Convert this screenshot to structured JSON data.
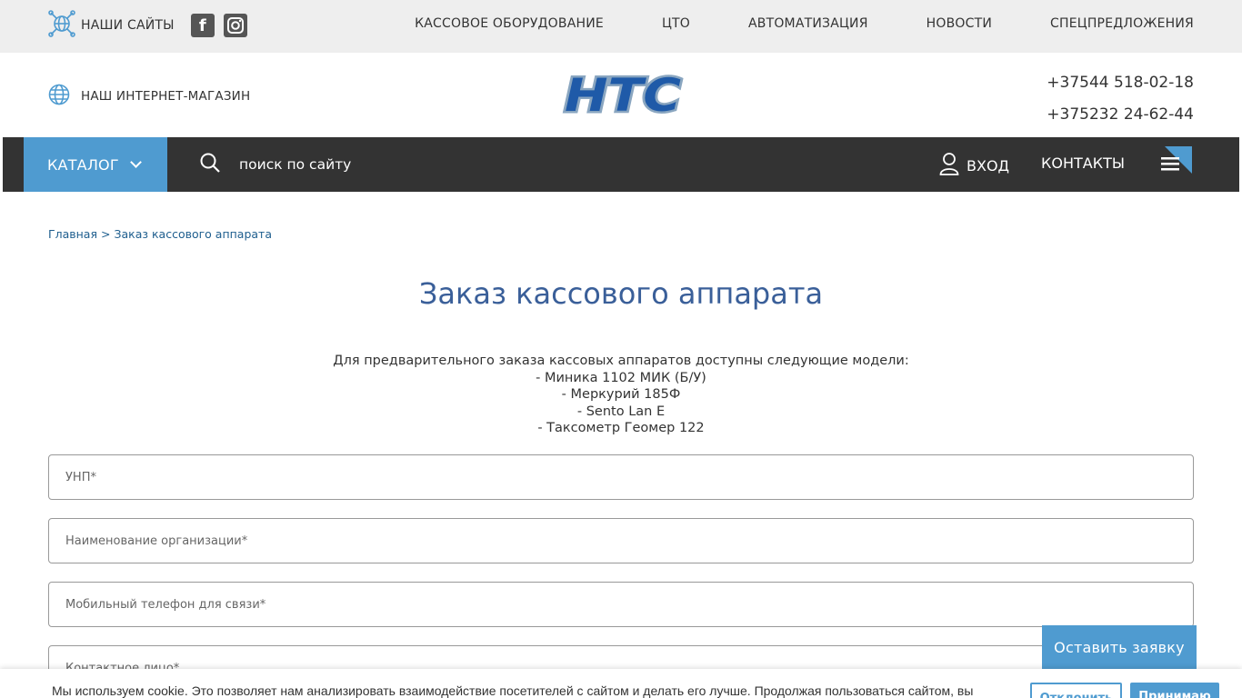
{
  "topbar": {
    "sites_label": "НАШИ САЙТЫ",
    "facebook_glyph": "f",
    "nav": [
      "КАССОВОЕ ОБОРУДОВАНИЕ",
      "ЦТО",
      "АВТОМАТИЗАЦИЯ",
      "НОВОСТИ",
      "СПЕЦПРЕДЛОЖЕНИЯ"
    ]
  },
  "header": {
    "shop_label": "НАШ ИНТЕРНЕТ-МАГАЗИН",
    "logo_text": "НТС",
    "phones": [
      "+37544 518-02-18",
      "+375232 24-62-44"
    ]
  },
  "navbar": {
    "catalog_label": "КАТАЛОГ",
    "search_placeholder": "поиск по сайту",
    "login_label": "ВХОД",
    "contacts_label": "КОНТАКТЫ"
  },
  "breadcrumb": {
    "home": "Главная",
    "separator": ">",
    "current": "Заказ кассового аппарата"
  },
  "page": {
    "title": "Заказ кассового аппарата",
    "intro": "Для предварительного заказа кассовых аппаратов доступны следующие модели:",
    "models": [
      "- Миника 1102 МИК (Б/У)",
      "- Меркурий 185Ф",
      "- Sento Lan E",
      "- Таксометр Геомер 122"
    ]
  },
  "form": {
    "fields": [
      "УНП*",
      "Наименование организации*",
      "Мобильный телефон для связи*",
      "Контактное лицо*"
    ],
    "submit_label": "Оставить заявку"
  },
  "cookie": {
    "text": "Мы используем cookie. Это позволяет нам анализировать взаимодействие посетителей с сайтом и делать его лучше. Продолжая пользоваться сайтом, вы",
    "decline_label": "Отклонить",
    "accept_label": "Принимаю"
  },
  "colors": {
    "accent": "#4f9bd0",
    "dark_bar": "#333333",
    "title": "#3a5f99",
    "topbar_bg": "#eeeeee"
  }
}
